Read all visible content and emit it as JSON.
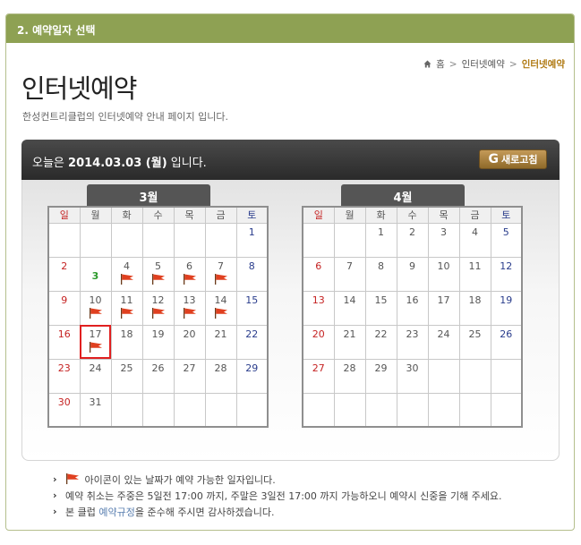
{
  "panel": {
    "header": "2. 예약일자 선택"
  },
  "breadcrumb": {
    "home": "홈",
    "sep1": ">",
    "item1": "인터넷예약",
    "sep2": ">",
    "current": "인터넷예약"
  },
  "title": "인터넷예약",
  "description": "한성컨트리클럽의 인터넷예약 안내 페이지 입니다.",
  "today": {
    "prefix": "오늘은",
    "date": "2014.03.03 (월)",
    "suffix": "입니다."
  },
  "refresh_label": "새로고침",
  "weekdays": [
    "일",
    "월",
    "화",
    "수",
    "목",
    "금",
    "토"
  ],
  "months": [
    {
      "label": "3월",
      "weeks": [
        [
          null,
          null,
          null,
          null,
          null,
          null,
          {
            "d": "1"
          }
        ],
        [
          {
            "d": "2"
          },
          {
            "d": "3",
            "today": true
          },
          {
            "d": "4",
            "flag": true
          },
          {
            "d": "5",
            "flag": true
          },
          {
            "d": "6",
            "flag": true
          },
          {
            "d": "7",
            "flag": true
          },
          {
            "d": "8"
          }
        ],
        [
          {
            "d": "9"
          },
          {
            "d": "10",
            "flag": true
          },
          {
            "d": "11",
            "flag": true
          },
          {
            "d": "12",
            "flag": true
          },
          {
            "d": "13",
            "flag": true
          },
          {
            "d": "14",
            "flag": true
          },
          {
            "d": "15"
          }
        ],
        [
          {
            "d": "16"
          },
          {
            "d": "17",
            "flag": true,
            "selected": true
          },
          {
            "d": "18"
          },
          {
            "d": "19"
          },
          {
            "d": "20"
          },
          {
            "d": "21"
          },
          {
            "d": "22"
          }
        ],
        [
          {
            "d": "23"
          },
          {
            "d": "24"
          },
          {
            "d": "25"
          },
          {
            "d": "26"
          },
          {
            "d": "27"
          },
          {
            "d": "28"
          },
          {
            "d": "29"
          }
        ],
        [
          {
            "d": "30"
          },
          {
            "d": "31"
          },
          null,
          null,
          null,
          null,
          null
        ]
      ]
    },
    {
      "label": "4월",
      "weeks": [
        [
          null,
          null,
          {
            "d": "1"
          },
          {
            "d": "2"
          },
          {
            "d": "3"
          },
          {
            "d": "4"
          },
          {
            "d": "5"
          }
        ],
        [
          {
            "d": "6"
          },
          {
            "d": "7"
          },
          {
            "d": "8"
          },
          {
            "d": "9"
          },
          {
            "d": "10"
          },
          {
            "d": "11"
          },
          {
            "d": "12"
          }
        ],
        [
          {
            "d": "13"
          },
          {
            "d": "14"
          },
          {
            "d": "15"
          },
          {
            "d": "16"
          },
          {
            "d": "17"
          },
          {
            "d": "18"
          },
          {
            "d": "19"
          }
        ],
        [
          {
            "d": "20"
          },
          {
            "d": "21"
          },
          {
            "d": "22"
          },
          {
            "d": "23"
          },
          {
            "d": "24"
          },
          {
            "d": "25"
          },
          {
            "d": "26"
          }
        ],
        [
          {
            "d": "27"
          },
          {
            "d": "28"
          },
          {
            "d": "29"
          },
          {
            "d": "30"
          },
          null,
          null,
          null
        ],
        [
          null,
          null,
          null,
          null,
          null,
          null,
          null
        ]
      ]
    }
  ],
  "notes": {
    "note1": "아이콘이 있는 날짜가 예약 가능한 일자입니다.",
    "note2": "예약 취소는 주중은 5일전 17:00 까지, 주말은 3일전 17:00 까지 가능하오니 예약시 신중을 기해 주세요.",
    "note3_a": "본 클럽 ",
    "note3_link": "예약규정",
    "note3_b": "을 준수해 주시면 감사하겠습니다."
  },
  "colors": {
    "header_bg": "#8ea153",
    "accent": "#b07a13",
    "sunday": "#c52222",
    "saturday": "#2a3d8c",
    "today": "#2b9a2b",
    "flag": "#e04020"
  },
  "icons": {
    "home": "home-icon",
    "flag": "flag-icon",
    "refresh": "refresh-icon"
  }
}
